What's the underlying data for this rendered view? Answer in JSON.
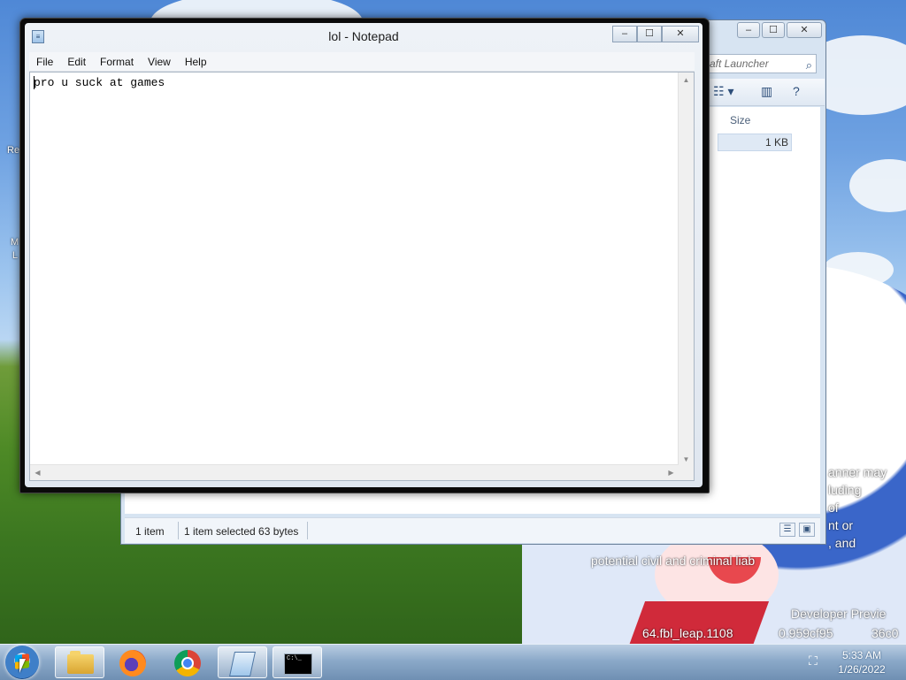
{
  "desktop": {
    "left_labels": [
      "Re",
      "M",
      "L"
    ],
    "watermark_lines": [
      "anner may",
      "luding",
      "of",
      "nt or",
      ", and",
      "potential civil and criminal liab"
    ],
    "build_lines": [
      "Developer Previe",
      "64.fbl_leap.1108",
      "0.959cf95",
      "36c0"
    ]
  },
  "explorer": {
    "search_placeholder": "aft Launcher",
    "search_icon": "search-icon",
    "column_size": "Size",
    "file_size": "1 KB",
    "status_items": "1 item",
    "status_selected": "1 item selected  63 bytes",
    "caption": {
      "minimize": "–",
      "maximize": "☐",
      "close": "✕"
    }
  },
  "notepad": {
    "title": "lol - Notepad",
    "menu": [
      "File",
      "Edit",
      "Format",
      "View",
      "Help"
    ],
    "content": "pro u suck at games",
    "caption": {
      "minimize": "–",
      "maximize": "☐",
      "close": "✕"
    }
  },
  "taskbar": {
    "items": [
      "start-button",
      "windows-explorer",
      "firefox",
      "chrome",
      "notepad",
      "command-prompt"
    ],
    "active": "notepad",
    "cmd_glyph": "C:\\_",
    "clock_time": "5:33 AM",
    "clock_date": "1/26/2022"
  },
  "colors": {
    "taskbar": "#8ba9c9",
    "window_frame": "#0a0a0a",
    "selection": "#dfe9f5"
  }
}
